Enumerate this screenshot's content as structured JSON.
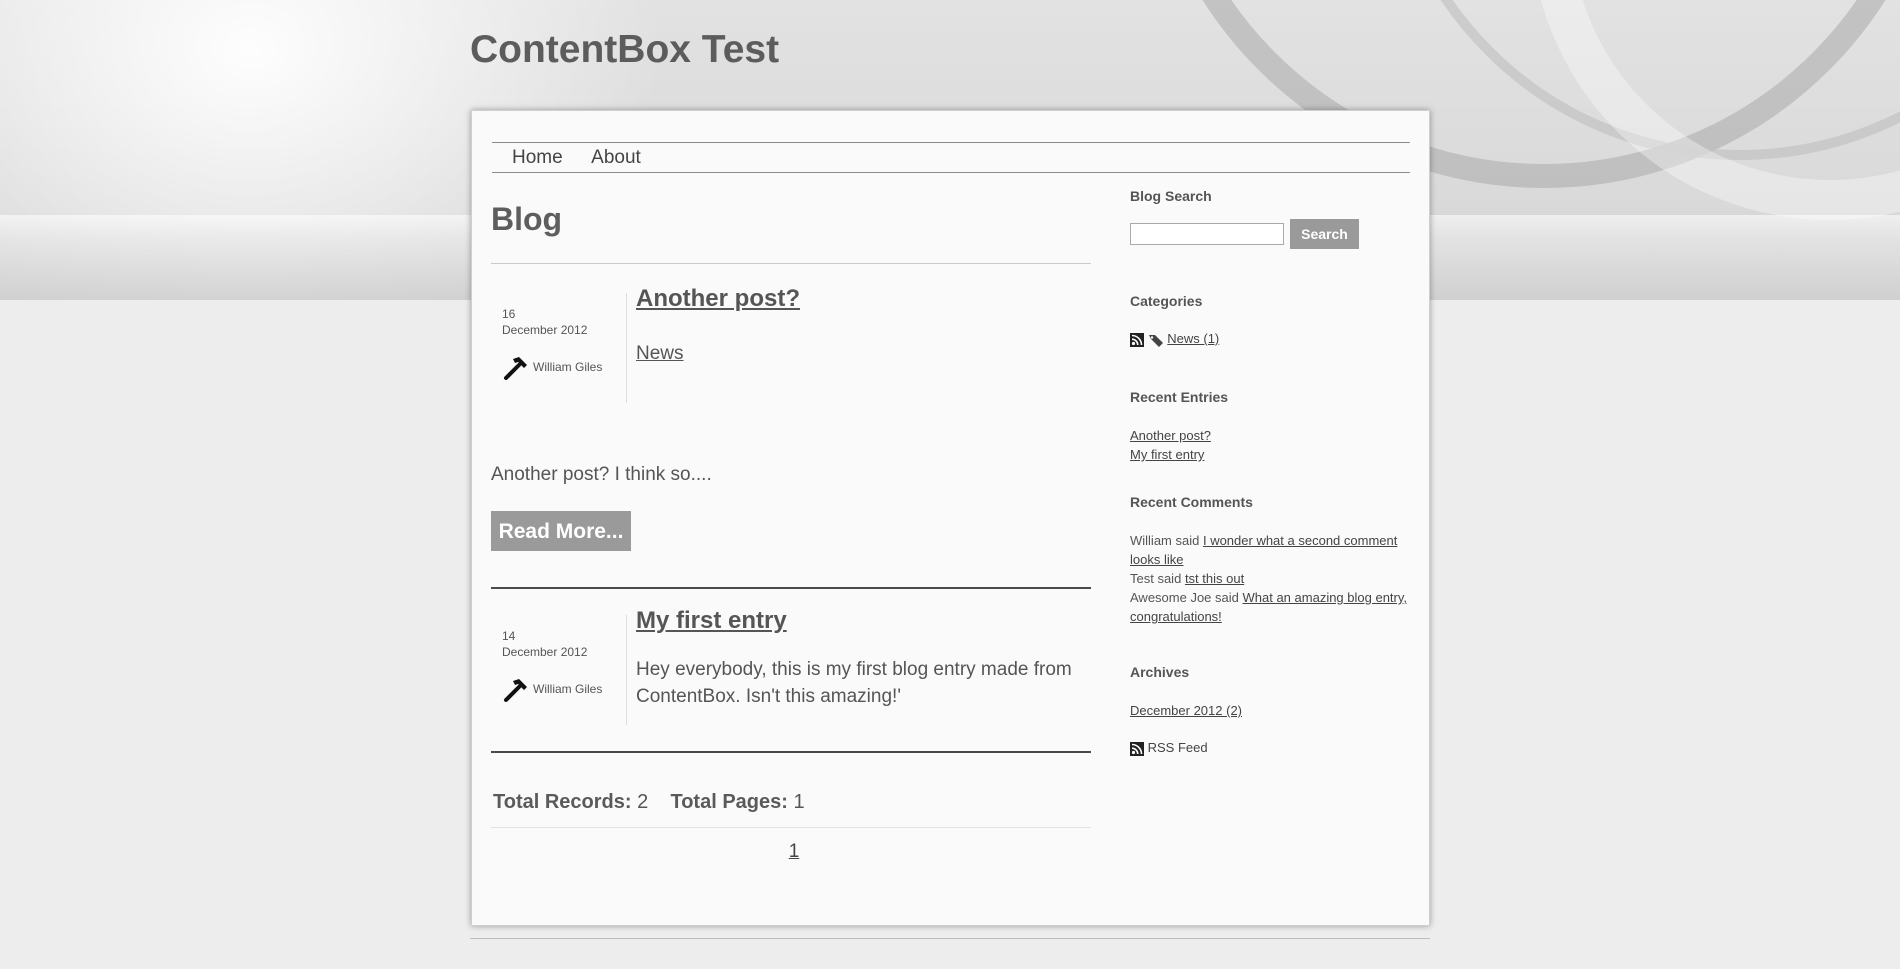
{
  "site": {
    "title": "ContentBox Test"
  },
  "nav": {
    "items": [
      {
        "label": "Home"
      },
      {
        "label": "About"
      }
    ]
  },
  "page": {
    "heading": "Blog"
  },
  "posts": [
    {
      "day": "16",
      "month_year": "December 2012",
      "author": "William Giles",
      "title": "Another post?",
      "category": "News",
      "excerpt": "Another post?  I think so....",
      "read_more": "Read More..."
    },
    {
      "day": "14",
      "month_year": "December 2012",
      "author": "William Giles",
      "title": "My first entry",
      "body": "Hey everybody, this is my first blog entry made from ContentBox. Isn't this amazing!'"
    }
  ],
  "totals": {
    "records_label": "Total Records:",
    "records_value": "2",
    "pages_label": "Total Pages:",
    "pages_value": "1"
  },
  "pagination": {
    "pages": [
      "1"
    ]
  },
  "sidebar": {
    "search": {
      "heading": "Blog Search",
      "button": "Search",
      "value": ""
    },
    "categories": {
      "heading": "Categories",
      "items": [
        {
          "label": "News (1)"
        }
      ]
    },
    "recent_entries": {
      "heading": "Recent Entries",
      "items": [
        {
          "label": "Another post?"
        },
        {
          "label": "My first entry"
        }
      ]
    },
    "recent_comments": {
      "heading": "Recent Comments",
      "items": [
        {
          "who": "William said",
          "text": "I wonder what a second comment looks like"
        },
        {
          "who": "Test said",
          "text": "tst this out"
        },
        {
          "who": "Awesome Joe said",
          "text": "What an amazing blog entry, congratulations!"
        }
      ]
    },
    "archives": {
      "heading": "Archives",
      "items": [
        {
          "label": "December 2012 (2)"
        }
      ]
    },
    "rss": {
      "label": "RSS Feed"
    }
  },
  "colors": {
    "button_bg": "#9a9a9a",
    "page_bg": "#ededed",
    "text": "#555555"
  }
}
